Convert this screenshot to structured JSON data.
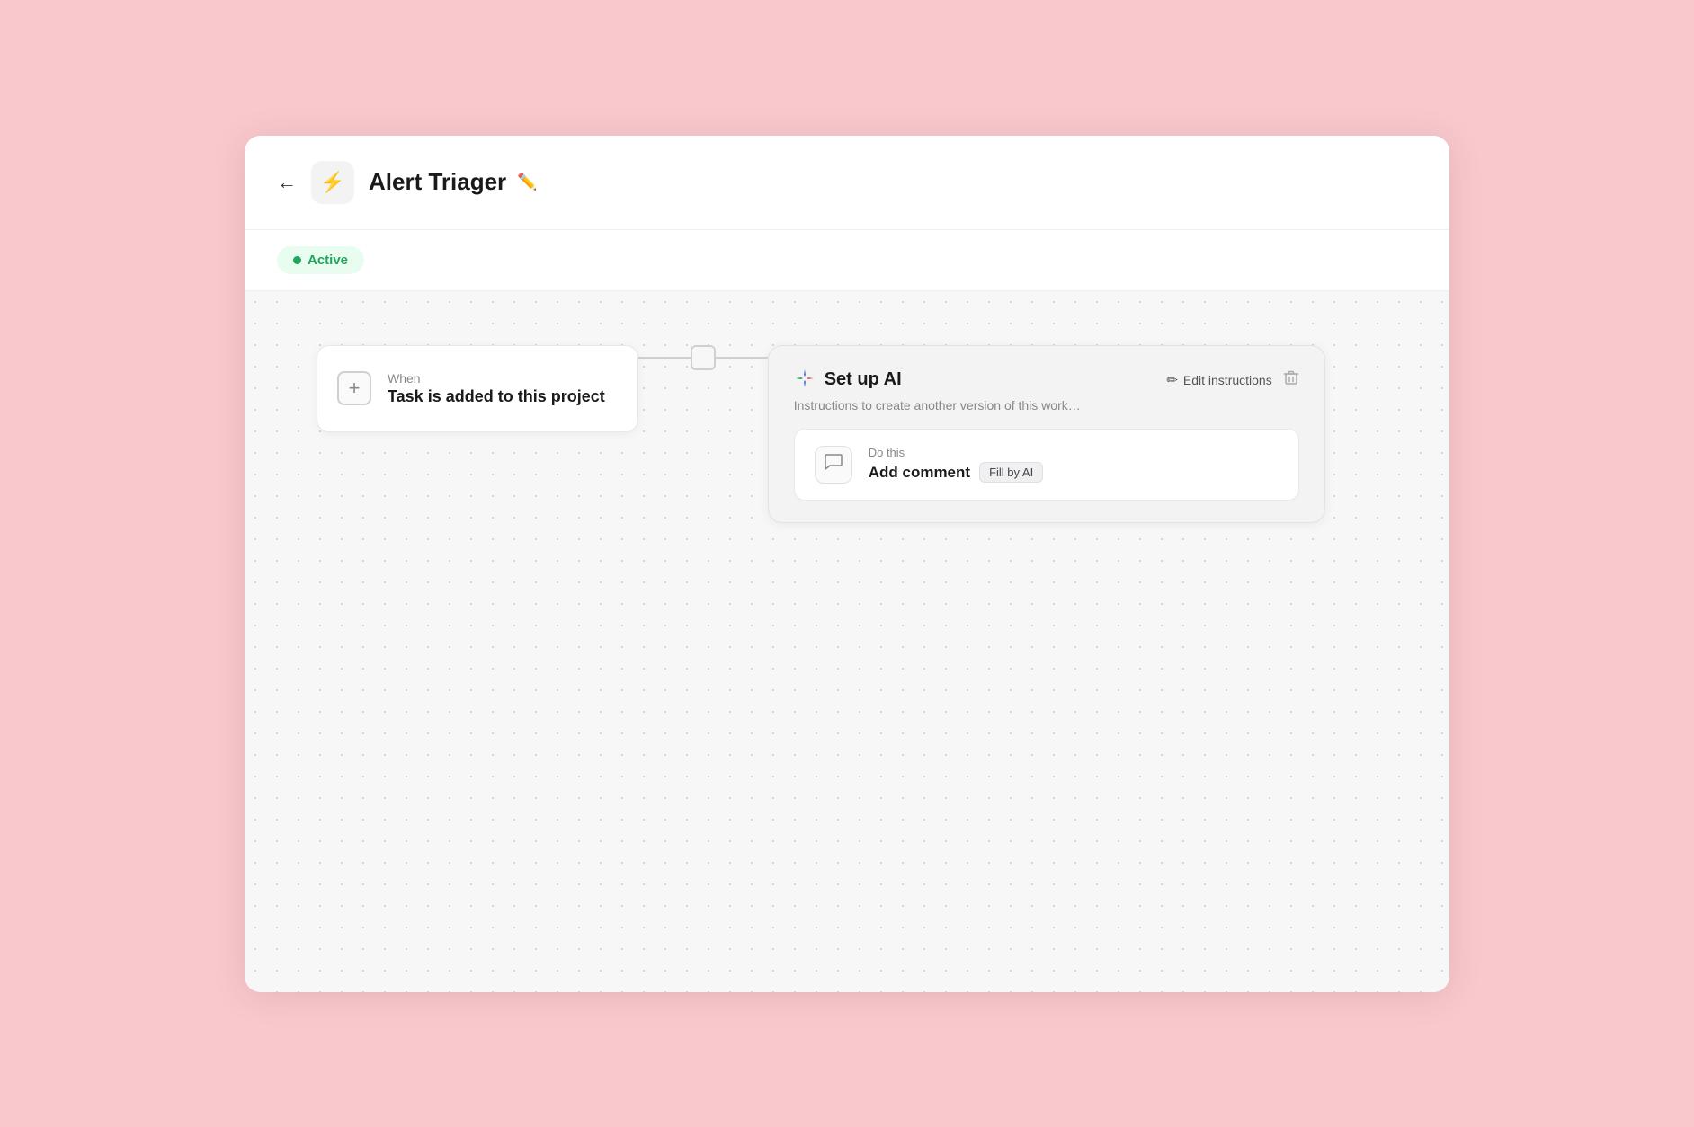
{
  "header": {
    "back_label": "←",
    "title": "Alert Triager",
    "edit_icon": "✏️"
  },
  "status": {
    "badge_label": "Active"
  },
  "trigger_card": {
    "add_label": "+",
    "when_label": "When",
    "action_label": "Task is added to this project"
  },
  "ai_card": {
    "sparkle_icon": "✦",
    "title": "Set up AI",
    "description": "Instructions to create another version of this work…",
    "edit_instructions_label": "Edit instructions",
    "edit_icon": "✏",
    "trash_icon": "🗑",
    "do_this": {
      "label": "Do this",
      "action": "Add comment",
      "badge": "Fill by AI"
    }
  },
  "colors": {
    "active_green": "#22a55a",
    "active_bg": "#e8fdf0",
    "accent_blue": "#4a80f0",
    "sparkle_red": "#e05c5c",
    "sparkle_blue": "#4a6ee0",
    "sparkle_green": "#22a55a"
  }
}
